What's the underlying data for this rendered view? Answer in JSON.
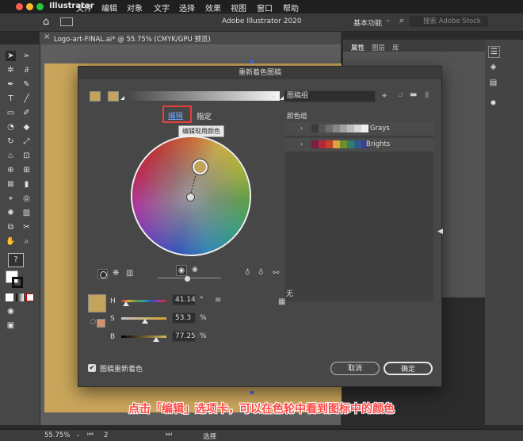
{
  "menubar": {
    "app_name": "Illustrator",
    "items": [
      "文件",
      "编辑",
      "对象",
      "文字",
      "选择",
      "效果",
      "视图",
      "窗口",
      "帮助"
    ]
  },
  "appbar": {
    "title": "Adobe Illustrator 2020",
    "workspace": "基本功能",
    "search_placeholder": "搜索 Adobe Stock"
  },
  "document_tab": {
    "label": "Logo-art-FINAL.ai* @ 55.75% (CMYK/GPU 预览)"
  },
  "panel_tabs": [
    "属性",
    "图层",
    "库"
  ],
  "dialog": {
    "title": "重新着色图稿",
    "artwork_dropdown": "图稿组",
    "tab_edit": "编辑",
    "tab_assign": "指定",
    "tooltip": "编辑现用颜色",
    "color_groups_label": "颜色组",
    "groups": [
      {
        "name": "Grays",
        "colors": [
          "#3a3a3a",
          "#555555",
          "#6e6e6e",
          "#888888",
          "#a2a2a2",
          "#bcbcbc",
          "#d6d6d6",
          "#efefef"
        ]
      },
      {
        "name": "Brights",
        "colors": [
          "#7a1f3d",
          "#b5283c",
          "#c8402e",
          "#d9a43a",
          "#6f8f2e",
          "#2f7f6a",
          "#2b5b8a",
          "#3d3f88"
        ]
      }
    ],
    "hsb": {
      "h_label": "H",
      "h_value": "41.14",
      "h_unit": "°",
      "h_fraction": 0.11,
      "s_label": "S",
      "s_value": "53.3",
      "s_unit": "%",
      "s_fraction": 0.53,
      "b_label": "B",
      "b_value": "77.25",
      "b_unit": "%",
      "b_fraction": 0.77
    },
    "none_label": "无",
    "recolor_checkbox": "图稿重新着色",
    "recolor_checked": true,
    "cancel": "取消",
    "ok": "确定",
    "active_color": "#c4a35a"
  },
  "status": {
    "zoom": "55.75%",
    "page": "2",
    "tool": "选择"
  },
  "caption": "点击「编辑」选项卡，可以在色轮中看到图标中的颜色"
}
